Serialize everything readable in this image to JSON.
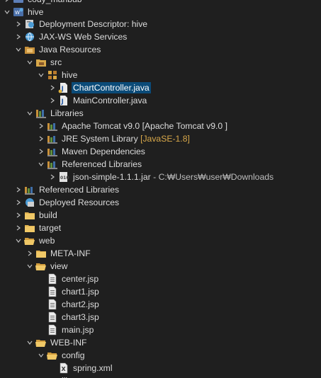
{
  "tree": {
    "top_partial": {
      "label": "cody_mahbub"
    },
    "hive": {
      "label": "hive"
    },
    "deployment_descriptor": {
      "label": "Deployment Descriptor: hive"
    },
    "jaxws": {
      "label": "JAX-WS Web Services"
    },
    "java_resources": {
      "label": "Java Resources"
    },
    "src": {
      "label": "src"
    },
    "pkg_hive": {
      "label": "hive"
    },
    "chart_controller": {
      "label": "ChartController.java"
    },
    "main_controller": {
      "label": "MainController.java"
    },
    "libraries": {
      "label": "Libraries"
    },
    "tomcat": {
      "label": "Apache Tomcat v9.0 [Apache Tomcat v9.0 ]"
    },
    "jre": {
      "label": "JRE System Library",
      "decoration": "[JavaSE-1.8]"
    },
    "maven": {
      "label": "Maven Dependencies"
    },
    "ref_libs_inner": {
      "label": "Referenced Libraries"
    },
    "json_simple": {
      "label": "json-simple-1.1.1.jar",
      "path": " - C:₩Users₩user₩Downloads"
    },
    "ref_libs": {
      "label": "Referenced Libraries"
    },
    "deployed": {
      "label": "Deployed Resources"
    },
    "build": {
      "label": "build"
    },
    "target": {
      "label": "target"
    },
    "web": {
      "label": "web"
    },
    "meta_inf": {
      "label": "META-INF"
    },
    "view": {
      "label": "view"
    },
    "center_jsp": {
      "label": "center.jsp"
    },
    "chart1_jsp": {
      "label": "chart1.jsp"
    },
    "chart2_jsp": {
      "label": "chart2.jsp"
    },
    "chart3_jsp": {
      "label": "chart3.jsp"
    },
    "main_jsp": {
      "label": "main.jsp"
    },
    "web_inf": {
      "label": "WEB-INF"
    },
    "config": {
      "label": "config"
    },
    "spring_xml": {
      "label": "spring.xml"
    },
    "bottom_partial": {
      "label": "lib"
    }
  },
  "colors": {
    "background": "#1f1f1f",
    "selection": "#0b4b78",
    "text": "#dcdcdc",
    "decoration": "#d8a84a"
  }
}
